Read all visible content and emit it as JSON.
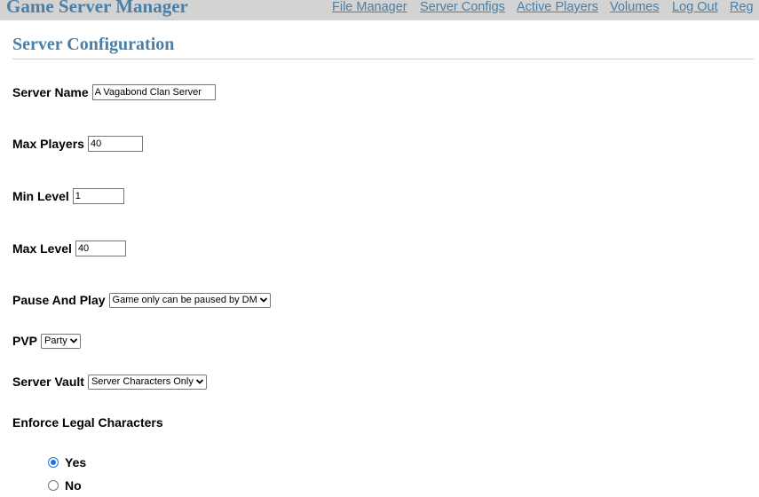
{
  "app": {
    "title": "Game Server Manager"
  },
  "nav": {
    "items": [
      {
        "label": "File Manager"
      },
      {
        "label": "Server Configs"
      },
      {
        "label": "Active Players"
      },
      {
        "label": "Volumes"
      },
      {
        "label": "Log Out"
      },
      {
        "label": "Reg"
      }
    ]
  },
  "page": {
    "title": "Server Configuration"
  },
  "form": {
    "server_name": {
      "label": "Server Name",
      "value": "A Vagabond Clan Server"
    },
    "max_players": {
      "label": "Max Players",
      "value": "40"
    },
    "min_level": {
      "label": "Min Level",
      "value": "1"
    },
    "max_level": {
      "label": "Max Level",
      "value": "40"
    },
    "pause_and_play": {
      "label": "Pause And Play",
      "selected": "Game only can be paused by DM"
    },
    "pvp": {
      "label": "PVP",
      "selected": "Party"
    },
    "server_vault": {
      "label": "Server Vault",
      "selected": "Server Characters Only"
    },
    "enforce_legal": {
      "label": "Enforce Legal Characters",
      "options": [
        {
          "label": "Yes",
          "checked": true
        },
        {
          "label": "No",
          "checked": false
        }
      ]
    }
  },
  "theme": {
    "accent": "#4a7fa6",
    "topbar_bg": "#d3d3d3",
    "radio_checked": "#1a73e8"
  }
}
